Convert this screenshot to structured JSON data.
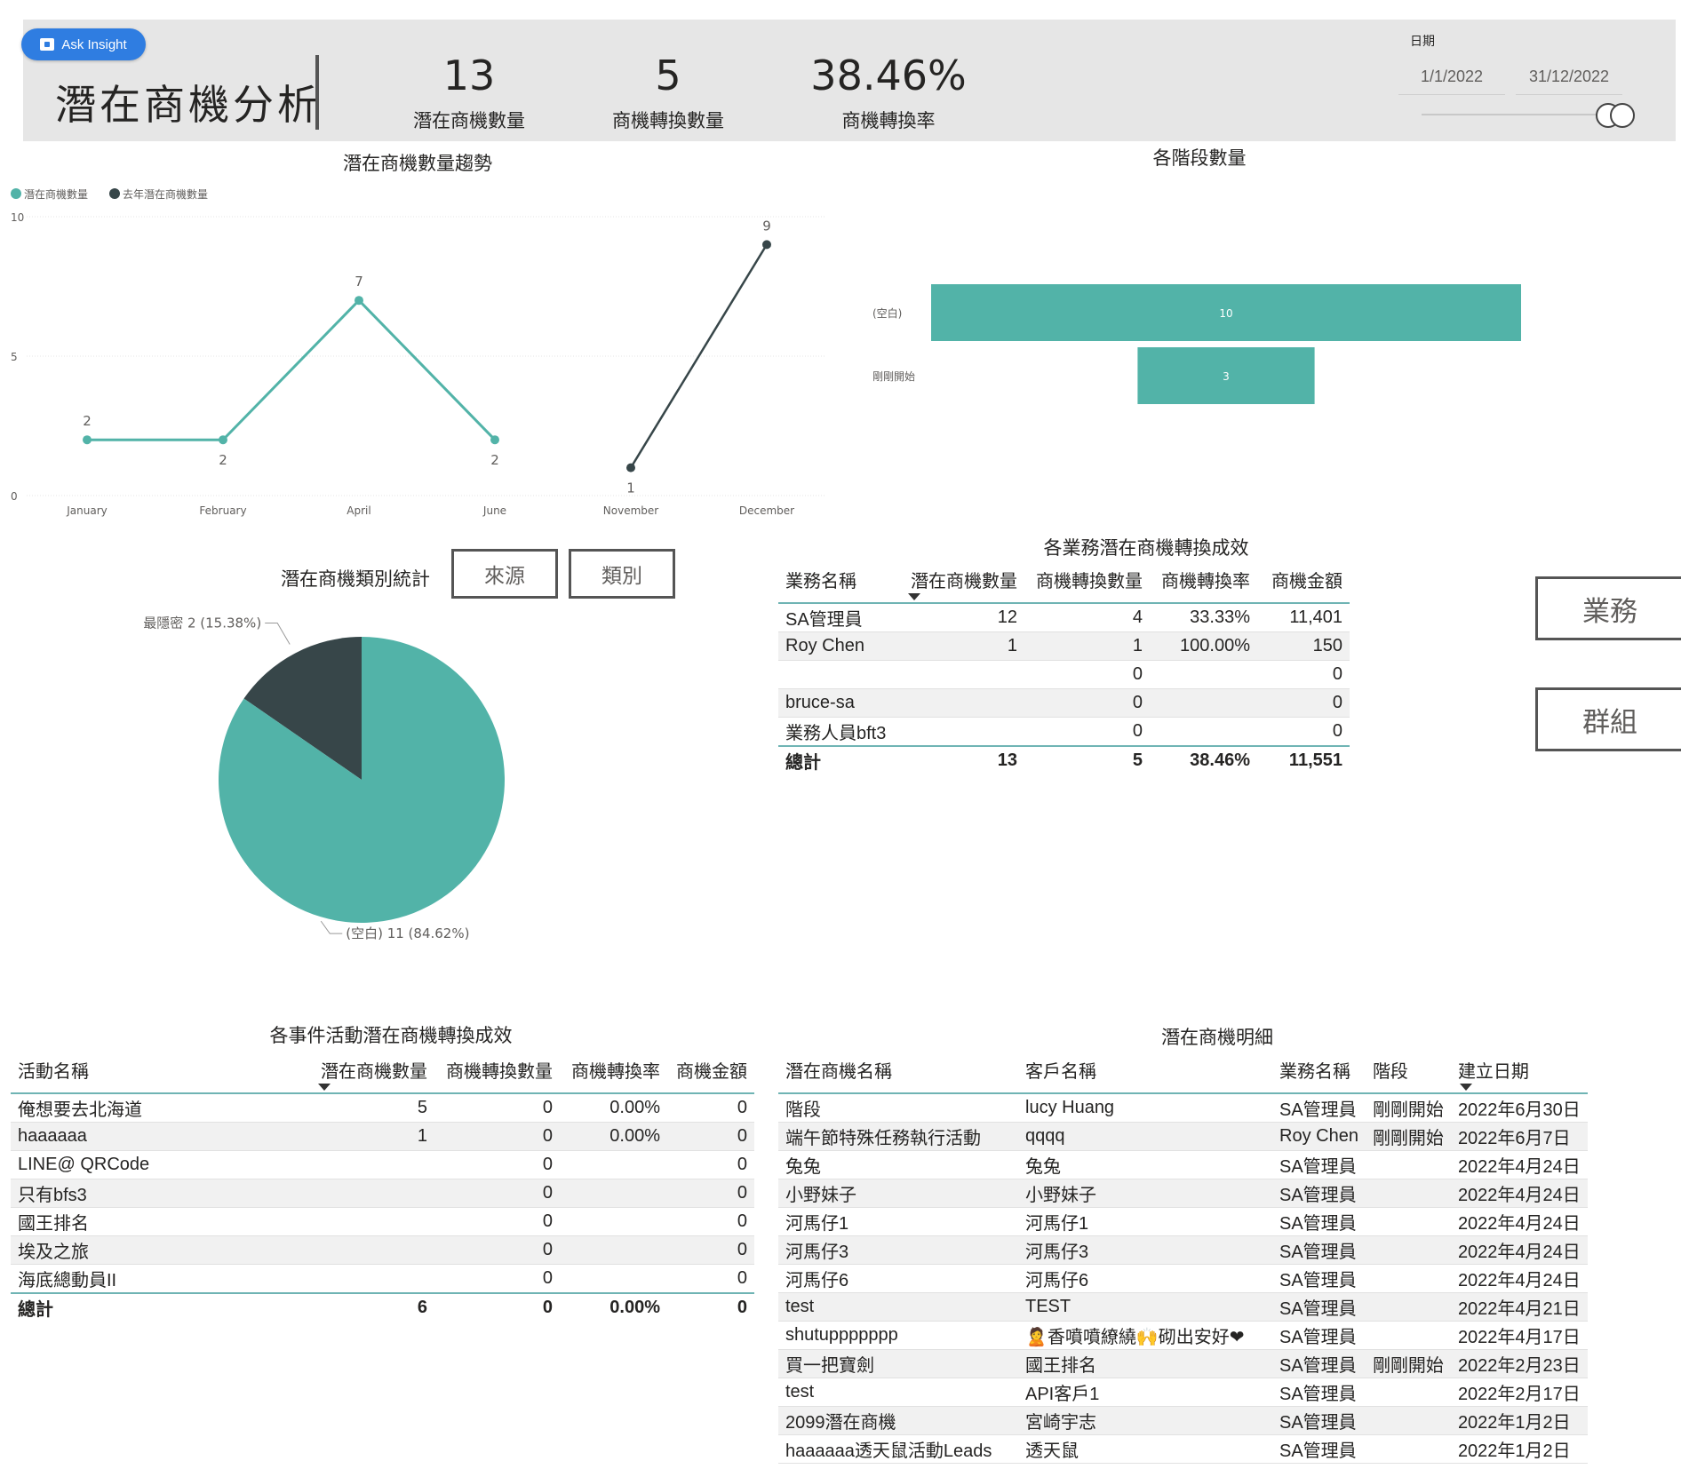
{
  "header": {
    "ask_insight": "Ask Insight",
    "title": "潛在商機分析",
    "kpis": [
      {
        "value": "13",
        "label": "潛在商機數量"
      },
      {
        "value": "5",
        "label": "商機轉換數量"
      },
      {
        "value": "38.46%",
        "label": "商機轉換率"
      }
    ],
    "date_filter": {
      "label": "日期",
      "start": "1/1/2022",
      "end": "31/12/2022"
    }
  },
  "trend_chart": {
    "title": "潛在商機數量趨勢",
    "legend": [
      "潛在商機數量",
      "去年潛在商機數量"
    ],
    "y_ticks": [
      "10",
      "5",
      "0"
    ],
    "x_labels": [
      "January",
      "February",
      "April",
      "June",
      "November",
      "December"
    ]
  },
  "stage_chart": {
    "title": "各階段數量",
    "categories": [
      "(空白)",
      "剛剛開始"
    ]
  },
  "category_pie": {
    "title": "潛在商機類別統計",
    "buttons": [
      "來源",
      "類別"
    ],
    "labels": [
      "最隱密 2 (15.38%)",
      "(空白) 11 (84.62%)"
    ]
  },
  "side_buttons": [
    "業務",
    "群組"
  ],
  "sales_table": {
    "title": "各業務潛在商機轉換成效",
    "columns": [
      "業務名稱",
      "潛在商機數量",
      "商機轉換數量",
      "商機轉換率",
      "商機金額"
    ],
    "rows": [
      [
        "SA管理員",
        "12",
        "4",
        "33.33%",
        "11,401"
      ],
      [
        "Roy Chen",
        "1",
        "1",
        "100.00%",
        "150"
      ],
      [
        "",
        "",
        "0",
        "",
        "0"
      ],
      [
        "bruce-sa",
        "",
        "0",
        "",
        "0"
      ],
      [
        "業務人員bft3",
        "",
        "0",
        "",
        "0"
      ]
    ],
    "total": [
      "總計",
      "13",
      "5",
      "38.46%",
      "11,551"
    ]
  },
  "event_table": {
    "title": "各事件活動潛在商機轉換成效",
    "columns": [
      "活動名稱",
      "潛在商機數量",
      "商機轉換數量",
      "商機轉換率",
      "商機金額"
    ],
    "rows": [
      [
        "俺想要去北海道",
        "5",
        "0",
        "0.00%",
        "0"
      ],
      [
        "haaaaaa",
        "1",
        "0",
        "0.00%",
        "0"
      ],
      [
        "LINE@ QRCode",
        "",
        "0",
        "",
        "0"
      ],
      [
        "只有bfs3",
        "",
        "0",
        "",
        "0"
      ],
      [
        "國王排名",
        "",
        "0",
        "",
        "0"
      ],
      [
        "埃及之旅",
        "",
        "0",
        "",
        "0"
      ],
      [
        "海底總動員II",
        "",
        "0",
        "",
        "0"
      ]
    ],
    "total": [
      "總計",
      "6",
      "0",
      "0.00%",
      "0"
    ]
  },
  "detail_table": {
    "title": "潛在商機明細",
    "columns": [
      "潛在商機名稱",
      "客戶名稱",
      "業務名稱",
      "階段",
      "建立日期"
    ],
    "rows": [
      [
        "階段",
        "lucy Huang",
        "SA管理員",
        "剛剛開始",
        "2022年6月30日"
      ],
      [
        "端午節特殊任務執行活動",
        "qqqq",
        "Roy Chen",
        "剛剛開始",
        "2022年6月7日"
      ],
      [
        "兔兔",
        "兔兔",
        "SA管理員",
        "",
        "2022年4月24日"
      ],
      [
        "小野妹子",
        "小野妹子",
        "SA管理員",
        "",
        "2022年4月24日"
      ],
      [
        "河馬仔1",
        "河馬仔1",
        "SA管理員",
        "",
        "2022年4月24日"
      ],
      [
        "河馬仔3",
        "河馬仔3",
        "SA管理員",
        "",
        "2022年4月24日"
      ],
      [
        "河馬仔6",
        "河馬仔6",
        "SA管理員",
        "",
        "2022年4月24日"
      ],
      [
        "test",
        "TEST",
        "SA管理員",
        "",
        "2022年4月21日"
      ],
      [
        "shutuppppppp",
        "🙎香噴噴繚繞🙌砌出安好❤",
        "SA管理員",
        "",
        "2022年4月17日"
      ],
      [
        "買一把寶劍",
        "國王排名",
        "SA管理員",
        "剛剛開始",
        "2022年2月23日"
      ],
      [
        "test",
        "API客戶1",
        "SA管理員",
        "",
        "2022年2月17日"
      ],
      [
        "2099潛在商機",
        "宮崎宇志",
        "SA管理員",
        "",
        "2022年1月2日"
      ],
      [
        "haaaaaa透天鼠活動Leads",
        "透天鼠",
        "SA管理員",
        "",
        "2022年1月2日"
      ]
    ]
  },
  "chart_data": [
    {
      "type": "line",
      "categories": [
        "January",
        "February",
        "April",
        "June",
        "November",
        "December"
      ],
      "series": [
        {
          "name": "潛在商機數量",
          "color": "#52b3a8",
          "values": [
            2,
            2,
            7,
            2,
            null,
            null
          ]
        },
        {
          "name": "去年潛在商機數量",
          "color": "#374649",
          "values": [
            null,
            null,
            null,
            null,
            1,
            9
          ]
        }
      ],
      "title": "潛在商機數量趨勢",
      "ylim": [
        0,
        10
      ],
      "legend": "top-left"
    },
    {
      "type": "bar",
      "orientation": "horizontal-funnel",
      "categories": [
        "(空白)",
        "剛剛開始"
      ],
      "values": [
        10,
        3
      ],
      "color": "#52b3a8",
      "title": "各階段數量"
    },
    {
      "type": "pie",
      "categories": [
        "最隱密",
        "(空白)"
      ],
      "values": [
        2,
        11
      ],
      "percents": [
        "15.38%",
        "84.62%"
      ],
      "colors": [
        "#374649",
        "#52b3a8"
      ],
      "title": "潛在商機類別統計"
    }
  ]
}
